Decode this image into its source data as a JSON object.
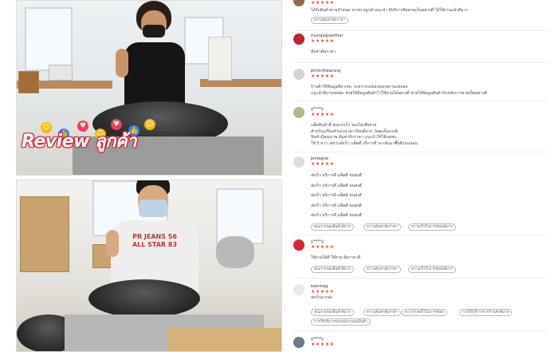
{
  "banner": {
    "word": "Review",
    "thai": "ลูกค้า"
  },
  "photo_top": {
    "shirt_text": ""
  },
  "photo_bottom": {
    "shirt_text": "PR JEANS 56 ALL STAR 83"
  },
  "colors": {
    "star": "#ee4d2d",
    "banner_stroke": "#d9232e",
    "tag_border": "#b7b7b7"
  },
  "reviews": [
    {
      "user": "",
      "stars": "★★★★★",
      "text": "ได้รับสินค้าตามกำหนด จากทางลูกค้าแนะนำ มีบริการติดตามเป็นอย่างดี ได้ใช้งานแล้วดีมาก",
      "tags": [
        "ความคุ้มค่าคุ้มราคา"
      ]
    },
    {
      "user": "mungsajsanthai",
      "stars": "★★★★★",
      "text": "คุ้มค่าคุ้มราคา",
      "tags": []
    },
    {
      "user": "phronthearung",
      "stars": "★★★★★",
      "text": "ร้านค้าให้ข้อมูลดีมากคะ ระหว่างรอของบอกสถานะตลอด\nแนะนำดีมากเลยค่ะ ช่วยให้ข้อมูลสินค้าไว้ใช้งานได้อย่างดี ช่วยให้ข้อมูลสินค้ากับหลังการขายเป็นอย่างดี",
      "tags": []
    },
    {
      "user": "y****y",
      "stars": "★★★★★",
      "text": "แพ็คสินค้าดี สะดวกเร็ว ของไม่เสียหาย\nสำหรับเครื่องทำเครป เตาเรียบดีมาก วัสดุแข็งแรงดี\nสินค้ามีคุณภาพ คุ้มค่ากับราคา แนะนำให้ใช้เลยค่ะ\nใช้ 5 ดาว เพราะส่งเร็ว แพ็คดี บริการดี จะกลับมาซื้ออีกแน่นอน",
      "tags": []
    },
    {
      "user": "jomegne",
      "stars": "★★★★★",
      "text": "ส่งเร็ว บริการดี แพ็คดี ขนส่งดี\nส่งเร็ว บริการดี แพ็คดี ขนส่งดี\nส่งเร็ว บริการดี แพ็คดี ขนส่งดี\nส่งเร็ว บริการดี แพ็คดี ขนส่งดี\nส่งเร็ว บริการดี แพ็คดี ขนส่งดี",
      "tags": [
        "คุณภาพของสินค้าดีมาก",
        "ความคุ้มค่าคุ้มราคา",
        "ความเร็วในการจัดส่งดีมาก"
      ]
    },
    {
      "user": "y****y",
      "stars": "★★★★★",
      "text": "ใช้งานได้ดี ใช้ง่าย คุ้มราคาดี",
      "tags": [
        "คุณภาพของสินค้าดีมาก",
        "ความคุ้มค่าคุ้มราคา",
        "ความเร็วในการจัดส่งดีมาก"
      ]
    },
    {
      "user": "kosrmag",
      "stars": "★★★★★",
      "text": "ส่งเร็วมากค่ะ",
      "tags": [
        "คุณภาพของสินค้าดีมาก",
        "ความคุ้มค่าคุ้มราคา",
        "ความรวดเร็วในการจัดส่ง",
        "การให้บริการจากร้านค้าดีมาก",
        "การให้บริการของพนักงานส่งสินค้า"
      ]
    },
    {
      "user": "y****y",
      "stars": "★★★★★",
      "text": "",
      "tags": []
    }
  ]
}
